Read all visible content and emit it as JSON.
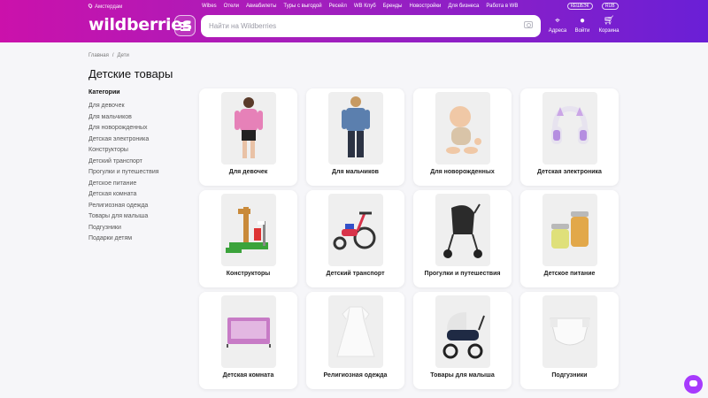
{
  "header": {
    "location": "Амстердам",
    "top_links": [
      "Wibes",
      "Отели",
      "Авиабилеты",
      "Туры с выгодой",
      "Ресейл",
      "WB Клуб",
      "Бренды",
      "Новостройки",
      "Для бизнеса",
      "Работа в WB"
    ],
    "cashback": "КЕШБЭК",
    "currency": "RUB",
    "logo": "wildberries",
    "search_placeholder": "Найти на Wildberries",
    "address_label": "Адреса",
    "login_label": "Войти",
    "cart_label": "Корзина"
  },
  "breadcrumb": [
    "Главная",
    "Дети"
  ],
  "page_title": "Детские товары",
  "sidebar": {
    "heading": "Категории",
    "items": [
      "Для девочек",
      "Для мальчиков",
      "Для новорожденных",
      "Детская электроника",
      "Конструкторы",
      "Детский транспорт",
      "Прогулки и путешествия",
      "Детское питание",
      "Детская комната",
      "Религиозная одежда",
      "Товары для малыша",
      "Подгузники",
      "Подарки детям"
    ]
  },
  "categories": [
    {
      "label": "Для девочек",
      "image": "girl-clothing-photo"
    },
    {
      "label": "Для мальчиков",
      "image": "boy-clothing-photo"
    },
    {
      "label": "Для новорожденных",
      "image": "baby-photo"
    },
    {
      "label": "Детская электроника",
      "image": "headphones-photo"
    },
    {
      "label": "Конструкторы",
      "image": "lego-set-photo"
    },
    {
      "label": "Детский транспорт",
      "image": "tricycle-photo"
    },
    {
      "label": "Прогулки и путешествия",
      "image": "stroller-photo"
    },
    {
      "label": "Детское питание",
      "image": "baby-food-jars-photo"
    },
    {
      "label": "Детская комната",
      "image": "playpen-photo"
    },
    {
      "label": "Религиозная одежда",
      "image": "christening-dress-photo"
    },
    {
      "label": "Товары для малыша",
      "image": "pram-photo"
    },
    {
      "label": "Подгузники",
      "image": "diaper-photo"
    }
  ],
  "colors": {
    "brand_start": "#cb11ab",
    "brand_end": "#6a1fd6",
    "chat": "#a73afd"
  }
}
